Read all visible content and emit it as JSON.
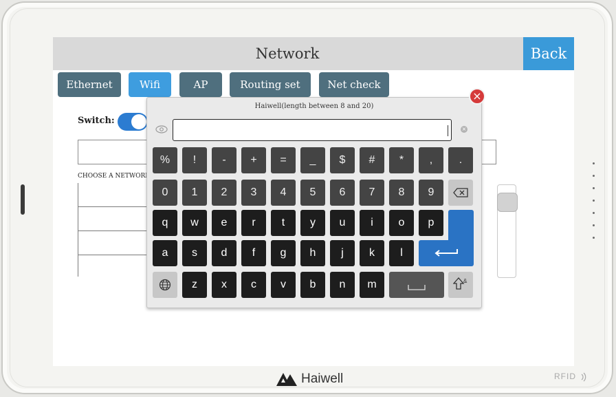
{
  "screen": {
    "title": "Network",
    "back_label": "Back",
    "tabs": [
      {
        "label": "Ethernet",
        "active": false
      },
      {
        "label": "Wifi",
        "active": true
      },
      {
        "label": "AP",
        "active": false
      },
      {
        "label": "Routing set",
        "active": false
      },
      {
        "label": "Net check",
        "active": false
      }
    ],
    "switch_label": "Switch:",
    "switch_on": true,
    "choose_label": "CHOOSE A NETWORK."
  },
  "keyboard": {
    "hint": "Haiwell(length between 8 and 20)",
    "input_value": "",
    "rows": [
      [
        "%",
        "!",
        "-",
        "+",
        "=",
        "_",
        "$",
        "#",
        "*",
        ",",
        "."
      ],
      [
        "0",
        "1",
        "2",
        "3",
        "4",
        "5",
        "6",
        "7",
        "8",
        "9"
      ],
      [
        "q",
        "w",
        "e",
        "r",
        "t",
        "y",
        "u",
        "i",
        "o",
        "p"
      ],
      [
        "a",
        "s",
        "d",
        "f",
        "g",
        "h",
        "j",
        "k",
        "l"
      ],
      [
        "z",
        "x",
        "c",
        "v",
        "b",
        "n",
        "m"
      ]
    ],
    "icons": {
      "backspace": "backspace-icon",
      "enter": "enter-icon",
      "globe": "globe-icon",
      "space": "space-icon",
      "shift": "shift-icon",
      "close": "close-icon",
      "eye": "eye-icon",
      "clear": "clear-icon"
    }
  },
  "device": {
    "brand": "Haiwell",
    "rfid_label": "RFID"
  },
  "colors": {
    "accent_blue": "#3a9ad9",
    "tab_inactive": "#4f6f7e",
    "enter_blue": "#2a73c4",
    "close_red": "#d53a3a"
  }
}
